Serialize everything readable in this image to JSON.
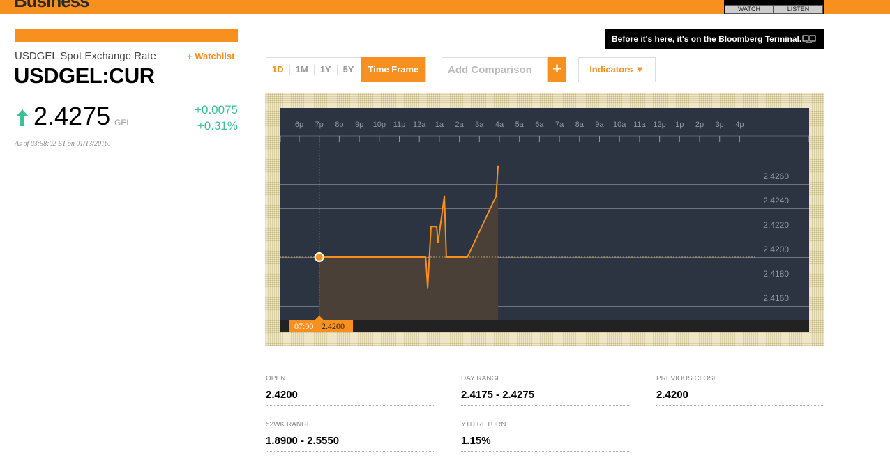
{
  "header": {
    "brand": "Business",
    "watch_label": "WATCH",
    "listen_label": "LISTEN",
    "accent": "#f7901e"
  },
  "quote": {
    "subtitle": "USDGEL Spot Exchange Rate",
    "watchlist_label": "+ Watchlist",
    "ticker": "USDGEL:CUR",
    "direction_icon": "arrow-up-icon",
    "price": "2.4275",
    "currency": "GEL",
    "change": "+0.0075",
    "change_pct": "+0.31%",
    "as_of": "As of 03:58:02 ET on 01/13/2016.",
    "up_color": "#3cc193"
  },
  "promo": {
    "text": "Before it's here, it's on the Bloomberg Terminal.",
    "icon": "terminal-icon"
  },
  "controls": {
    "ranges": [
      {
        "label": "1D",
        "active": true
      },
      {
        "label": "1M"
      },
      {
        "label": "1Y"
      },
      {
        "label": "5Y"
      }
    ],
    "timeframe_label": "Time Frame",
    "comparison_placeholder": "Add Comparison",
    "comparison_add": "+",
    "indicators_label": "Indicators ▼"
  },
  "chart_data": {
    "type": "area",
    "x_tick_labels": [
      "6p",
      "7p",
      "8p",
      "9p",
      "10p",
      "11p",
      "12a",
      "1a",
      "2a",
      "3a",
      "4a",
      "5a",
      "6a",
      "7a",
      "8a",
      "9a",
      "10a",
      "11a",
      "12p",
      "1p",
      "2p",
      "3p",
      "4p"
    ],
    "y_tick_labels": [
      "2.4260",
      "2.4240",
      "2.4220",
      "2.4200",
      "2.4180",
      "2.4160"
    ],
    "ylim": [
      2.4149,
      2.4294
    ],
    "reference_line": 2.42,
    "grid": true,
    "series": [
      {
        "color": "#f7901e",
        "points": [
          [
            "19:00",
            2.42
          ],
          [
            "00:19",
            2.42
          ],
          [
            "00:25",
            2.4175
          ],
          [
            "00:35",
            2.4225
          ],
          [
            "00:52",
            2.4225
          ],
          [
            "00:56",
            2.4212
          ],
          [
            "01:15",
            2.425
          ],
          [
            "01:21",
            2.42
          ],
          [
            "02:24",
            2.42
          ],
          [
            "03:50",
            2.425
          ],
          [
            "03:56",
            2.4275
          ]
        ]
      }
    ],
    "cursor": {
      "time": "07:00",
      "value": "2.4200"
    }
  },
  "stats": [
    {
      "label": "OPEN",
      "value": "2.4200"
    },
    {
      "label": "DAY RANGE",
      "value": "2.4175 - 2.4275"
    },
    {
      "label": "PREVIOUS CLOSE",
      "value": "2.4200"
    },
    {
      "label": "52WK RANGE",
      "value": "1.8900 - 2.5550"
    },
    {
      "label": "YTD RETURN",
      "value": "1.15%"
    }
  ]
}
